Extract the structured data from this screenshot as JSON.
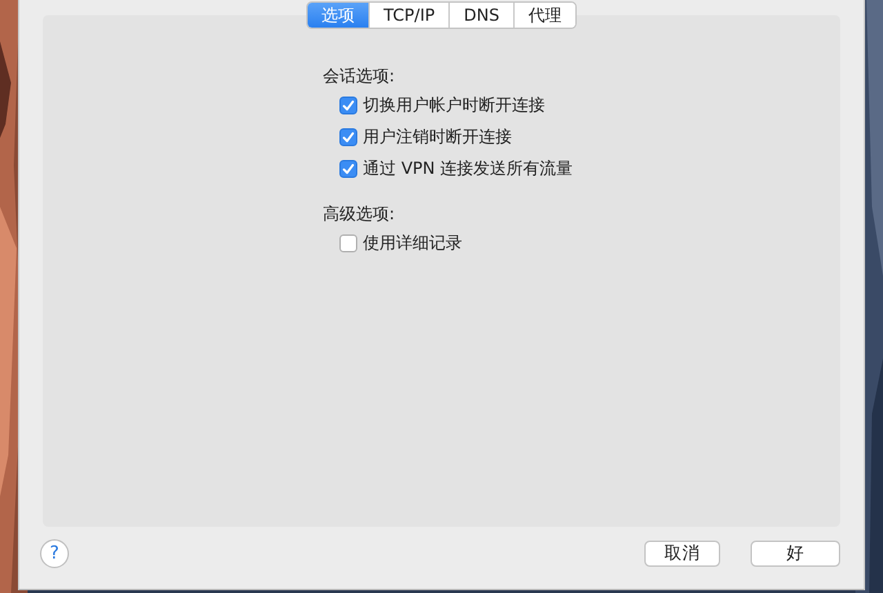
{
  "tabs": [
    {
      "label": "选项",
      "selected": true
    },
    {
      "label": "TCP/IP",
      "selected": false
    },
    {
      "label": "DNS",
      "selected": false
    },
    {
      "label": "代理",
      "selected": false
    }
  ],
  "sections": [
    {
      "heading": "会话选项:",
      "options": [
        {
          "label": "切换用户帐户时断开连接",
          "checked": true
        },
        {
          "label": "用户注销时断开连接",
          "checked": true
        },
        {
          "label": "通过 VPN 连接发送所有流量",
          "checked": true
        }
      ]
    },
    {
      "heading": "高级选项:",
      "options": [
        {
          "label": "使用详细记录",
          "checked": false
        }
      ]
    }
  ],
  "help": "?",
  "buttons": [
    "取消",
    "好"
  ]
}
